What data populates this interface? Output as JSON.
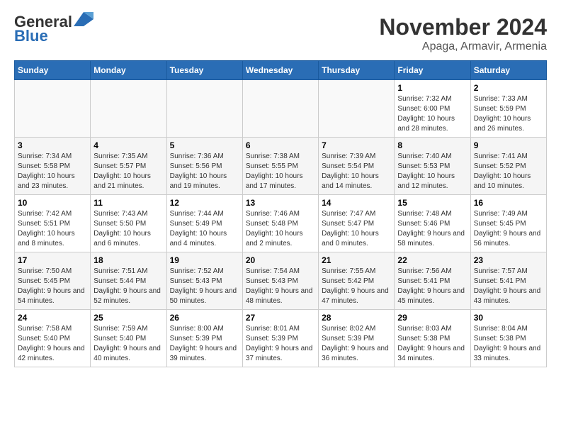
{
  "header": {
    "logo_line1": "General",
    "logo_line2": "Blue",
    "title": "November 2024",
    "subtitle": "Apaga, Armavir, Armenia"
  },
  "calendar": {
    "days_of_week": [
      "Sunday",
      "Monday",
      "Tuesday",
      "Wednesday",
      "Thursday",
      "Friday",
      "Saturday"
    ],
    "weeks": [
      [
        {
          "day": "",
          "info": ""
        },
        {
          "day": "",
          "info": ""
        },
        {
          "day": "",
          "info": ""
        },
        {
          "day": "",
          "info": ""
        },
        {
          "day": "",
          "info": ""
        },
        {
          "day": "1",
          "info": "Sunrise: 7:32 AM\nSunset: 6:00 PM\nDaylight: 10 hours and 28 minutes."
        },
        {
          "day": "2",
          "info": "Sunrise: 7:33 AM\nSunset: 5:59 PM\nDaylight: 10 hours and 26 minutes."
        }
      ],
      [
        {
          "day": "3",
          "info": "Sunrise: 7:34 AM\nSunset: 5:58 PM\nDaylight: 10 hours and 23 minutes."
        },
        {
          "day": "4",
          "info": "Sunrise: 7:35 AM\nSunset: 5:57 PM\nDaylight: 10 hours and 21 minutes."
        },
        {
          "day": "5",
          "info": "Sunrise: 7:36 AM\nSunset: 5:56 PM\nDaylight: 10 hours and 19 minutes."
        },
        {
          "day": "6",
          "info": "Sunrise: 7:38 AM\nSunset: 5:55 PM\nDaylight: 10 hours and 17 minutes."
        },
        {
          "day": "7",
          "info": "Sunrise: 7:39 AM\nSunset: 5:54 PM\nDaylight: 10 hours and 14 minutes."
        },
        {
          "day": "8",
          "info": "Sunrise: 7:40 AM\nSunset: 5:53 PM\nDaylight: 10 hours and 12 minutes."
        },
        {
          "day": "9",
          "info": "Sunrise: 7:41 AM\nSunset: 5:52 PM\nDaylight: 10 hours and 10 minutes."
        }
      ],
      [
        {
          "day": "10",
          "info": "Sunrise: 7:42 AM\nSunset: 5:51 PM\nDaylight: 10 hours and 8 minutes."
        },
        {
          "day": "11",
          "info": "Sunrise: 7:43 AM\nSunset: 5:50 PM\nDaylight: 10 hours and 6 minutes."
        },
        {
          "day": "12",
          "info": "Sunrise: 7:44 AM\nSunset: 5:49 PM\nDaylight: 10 hours and 4 minutes."
        },
        {
          "day": "13",
          "info": "Sunrise: 7:46 AM\nSunset: 5:48 PM\nDaylight: 10 hours and 2 minutes."
        },
        {
          "day": "14",
          "info": "Sunrise: 7:47 AM\nSunset: 5:47 PM\nDaylight: 10 hours and 0 minutes."
        },
        {
          "day": "15",
          "info": "Sunrise: 7:48 AM\nSunset: 5:46 PM\nDaylight: 9 hours and 58 minutes."
        },
        {
          "day": "16",
          "info": "Sunrise: 7:49 AM\nSunset: 5:45 PM\nDaylight: 9 hours and 56 minutes."
        }
      ],
      [
        {
          "day": "17",
          "info": "Sunrise: 7:50 AM\nSunset: 5:45 PM\nDaylight: 9 hours and 54 minutes."
        },
        {
          "day": "18",
          "info": "Sunrise: 7:51 AM\nSunset: 5:44 PM\nDaylight: 9 hours and 52 minutes."
        },
        {
          "day": "19",
          "info": "Sunrise: 7:52 AM\nSunset: 5:43 PM\nDaylight: 9 hours and 50 minutes."
        },
        {
          "day": "20",
          "info": "Sunrise: 7:54 AM\nSunset: 5:43 PM\nDaylight: 9 hours and 48 minutes."
        },
        {
          "day": "21",
          "info": "Sunrise: 7:55 AM\nSunset: 5:42 PM\nDaylight: 9 hours and 47 minutes."
        },
        {
          "day": "22",
          "info": "Sunrise: 7:56 AM\nSunset: 5:41 PM\nDaylight: 9 hours and 45 minutes."
        },
        {
          "day": "23",
          "info": "Sunrise: 7:57 AM\nSunset: 5:41 PM\nDaylight: 9 hours and 43 minutes."
        }
      ],
      [
        {
          "day": "24",
          "info": "Sunrise: 7:58 AM\nSunset: 5:40 PM\nDaylight: 9 hours and 42 minutes."
        },
        {
          "day": "25",
          "info": "Sunrise: 7:59 AM\nSunset: 5:40 PM\nDaylight: 9 hours and 40 minutes."
        },
        {
          "day": "26",
          "info": "Sunrise: 8:00 AM\nSunset: 5:39 PM\nDaylight: 9 hours and 39 minutes."
        },
        {
          "day": "27",
          "info": "Sunrise: 8:01 AM\nSunset: 5:39 PM\nDaylight: 9 hours and 37 minutes."
        },
        {
          "day": "28",
          "info": "Sunrise: 8:02 AM\nSunset: 5:39 PM\nDaylight: 9 hours and 36 minutes."
        },
        {
          "day": "29",
          "info": "Sunrise: 8:03 AM\nSunset: 5:38 PM\nDaylight: 9 hours and 34 minutes."
        },
        {
          "day": "30",
          "info": "Sunrise: 8:04 AM\nSunset: 5:38 PM\nDaylight: 9 hours and 33 minutes."
        }
      ]
    ]
  }
}
